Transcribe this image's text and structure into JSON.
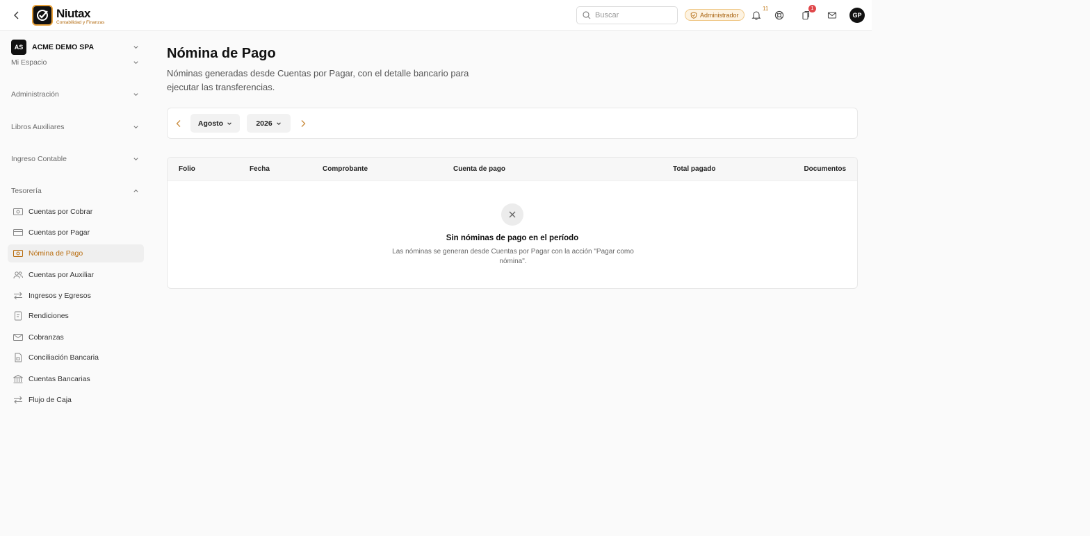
{
  "header": {
    "brand_name": "Niutax",
    "brand_tagline": "Contabilidad y Finanzas",
    "search_placeholder": "Buscar",
    "role_badge": "Administrador",
    "notifications_count": "11",
    "tasks_count": "1",
    "user_initials": "GP"
  },
  "sidebar": {
    "company_initials": "AS",
    "company_name": "ACME DEMO SPA",
    "sections": [
      "Mi Espacio",
      "Administración",
      "Libros Auxiliares",
      "Ingreso Contable",
      "Tesorería"
    ],
    "items": [
      {
        "label": "Cuentas por Cobrar",
        "icon": "money-icon"
      },
      {
        "label": "Cuentas por Pagar",
        "icon": "card-icon"
      },
      {
        "label": "Nómina de Pago",
        "icon": "money-icon"
      },
      {
        "label": "Cuentas por Auxiliar",
        "icon": "users-icon"
      },
      {
        "label": "Ingresos y Egresos",
        "icon": "arrows-icon"
      },
      {
        "label": "Rendiciones",
        "icon": "receipt-icon"
      },
      {
        "label": "Cobranzas",
        "icon": "mail-icon"
      },
      {
        "label": "Conciliación Bancaria",
        "icon": "doc-lock-icon"
      },
      {
        "label": "Cuentas Bancarias",
        "icon": "bank-icon"
      },
      {
        "label": "Flujo de Caja",
        "icon": "arrows-icon"
      }
    ],
    "active_item": "Nómina de Pago"
  },
  "main": {
    "title": "Nómina de Pago",
    "description": "Nóminas generadas desde Cuentas por Pagar, con el detalle bancario para ejecutar las transferencias.",
    "period": {
      "month": "Agosto",
      "year": "2026"
    },
    "table": {
      "columns": [
        "Folio",
        "Fecha",
        "Comprobante",
        "Cuenta de pago",
        "Total pagado",
        "Documentos"
      ]
    },
    "empty": {
      "title": "Sin nóminas de pago en el período",
      "description": "Las nóminas se generan desde Cuentas por Pagar con la acción \"Pagar como nómina\"."
    }
  },
  "colors": {
    "accent": "#b86c0e",
    "active_bg": "#efefef",
    "badge_red": "#e0484b"
  }
}
